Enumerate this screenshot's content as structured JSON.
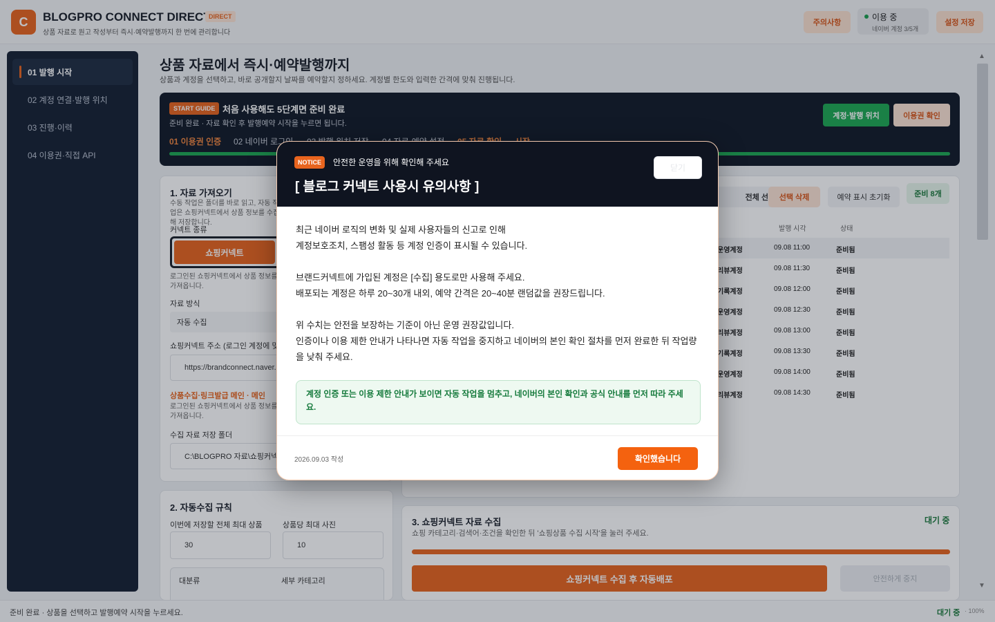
{
  "header": {
    "logo_letter": "C",
    "title": "BLOGPRO CONNECT DIRECT",
    "badge": "DIRECT",
    "subtitle": "상품 자료로 원고 작성부터 즉시·예약발행까지 한 번에 관리합니다",
    "notice_button": "주의사항",
    "status_label": "이용 중",
    "status_sub": "네이버 계정 3/5개",
    "save_button": "설정 저장"
  },
  "sidebar": {
    "items": [
      {
        "label": "01  발행 시작"
      },
      {
        "label": "02  계정 연결·발행 위치"
      },
      {
        "label": "03  진행·이력"
      },
      {
        "label": "04  이용권·직접 API"
      }
    ]
  },
  "main": {
    "title": "상품 자료에서 즉시·예약발행까지",
    "subtitle": "상품과 계정을 선택하고, 바로 공개할지 날짜를 예약할지 정하세요. 계정별 한도와 입력한 간격에 맞춰 진행됩니다."
  },
  "guide": {
    "badge": "START GUIDE",
    "title": "처음 사용해도 5단계면 준비 완료",
    "subtitle": "준비 완료 · 자료 확인 후 발행예약 시작을 누르면 됩니다.",
    "steps": [
      "01 이용권 인증",
      "02 네이버 로그인",
      "03 발행 위치 저장",
      "04 자료·예약 설정",
      "05 자료 확인 → 시작"
    ],
    "account_button": "계정·발행 위치",
    "license_button": "이용권 확인"
  },
  "panel1": {
    "title": "1. 자료 가져오기",
    "desc": "수동 작업은 폴더를 바로 읽고, 자동 작업은 쇼핑커넥트에서 상품 정보를 수집해 저장합니다.",
    "type_label": "커넥트 종류",
    "type_value": "쇼핑커넥트",
    "type_desc": "로그인된 쇼핑커넥트에서 상품 정보를 가져옵니다.",
    "method_label": "자료 방식",
    "method_value": "자동 수집",
    "url_label": "쇼핑커넥트 주소 (로그인 계정에 맞게)",
    "url_value": "https://brandconnect.naver.com",
    "link_label": "상품수집·링크발급 메인 · 메인",
    "link_desc": "로그인된 쇼핑커넥트에서 상품 정보를 가져옵니다.",
    "folder_label": "수집 자료 저장 폴더",
    "folder_value": "C:\\BLOGPRO 자료\\쇼핑커넥트"
  },
  "panel2": {
    "title": "2. 자동수집 규칙",
    "max_label": "이번에 저장할 전체 최대 상품",
    "max_value": "30",
    "photo_label": "상품당 최대 사진",
    "photo_value": "10",
    "cat_label": "대분류",
    "subcat_label": "세부 카테고리"
  },
  "table": {
    "select_toggle": "전체 선택/해제",
    "delete_selected": "선택 삭제",
    "reset_schedule": "예약 표시 초기화",
    "ready_count": "준비 8개",
    "col_time": "발행 시각",
    "col_status": "상태",
    "rows": [
      {
        "account": "운영계정",
        "time": "09.08 11:00",
        "status": "준비됨"
      },
      {
        "account": "리뷰계정",
        "time": "09.08 11:30",
        "status": "준비됨"
      },
      {
        "account": "기록계정",
        "time": "09.08 12:00",
        "status": "준비됨"
      },
      {
        "account": "운영계정",
        "time": "09.08 12:30",
        "status": "준비됨"
      },
      {
        "account": "리뷰계정",
        "time": "09.08 13:00",
        "status": "준비됨"
      },
      {
        "account": "기록계정",
        "time": "09.08 13:30",
        "status": "준비됨"
      },
      {
        "account": "운영계정",
        "time": "09.08 14:00",
        "status": "준비됨"
      },
      {
        "account": "리뷰계정",
        "time": "09.08 14:30",
        "status": "준비됨"
      }
    ]
  },
  "panel3": {
    "title": "3. 쇼핑커넥트 자료 수집",
    "status": "대기 중",
    "desc": "쇼핑 카테고리·검색어·조건을 확인한 뒤 '쇼핑상품 수집 시작'을 눌러 주세요.",
    "progress": 1.0,
    "start_button": "쇼핑커넥트 수집 후 자동배포",
    "stop_button": "안전하게 중지"
  },
  "footer": {
    "message": "준비 완료 · 상품을 선택하고 발행예약 시작을 누르세요.",
    "status": "대기 중",
    "zoom": "· 100%"
  },
  "modal": {
    "notice_badge": "NOTICE",
    "subtitle": "안전한 운영을 위해 확인해 주세요",
    "title": "[ 블로그 커넥트 사용시 유의사항 ]",
    "close_button": "닫기",
    "para1_line1": "최근 네이버 로직의 변화 및 실제 사용자들의 신고로 인해",
    "para1_line2": "계정보호조치, 스팸성 활동 등 계정 인증이 표시될 수 있습니다.",
    "para2_line1": "브랜드커넥트에 가입된 계정은 [수집] 용도로만 사용해 주세요.",
    "para2_line2": "배포되는 계정은 하루 20~30개 내외, 예약 간격은 20~40분 랜덤값을 권장드립니다.",
    "para3_line1": "위 수치는 안전을 보장하는 기준이 아닌 운영 권장값입니다.",
    "para3_line2": "인증이나 이용 제한 안내가 나타나면 자동 작업을 중지하고 네이버의 본인 확인 절차를 먼저 완료한 뒤 작업량을 낮춰 주세요.",
    "alert": "계정 인증 또는 이용 제한 안내가 보이면 자동 작업을 멈추고, 네이버의 본인 확인과 공식 안내를 먼저 따라 주세요.",
    "date": "2026.09.03 작성",
    "confirm_button": "확인했습니다"
  },
  "colors": {
    "accent": "#e8641e",
    "dark": "#111a27",
    "success": "#1ea852"
  }
}
